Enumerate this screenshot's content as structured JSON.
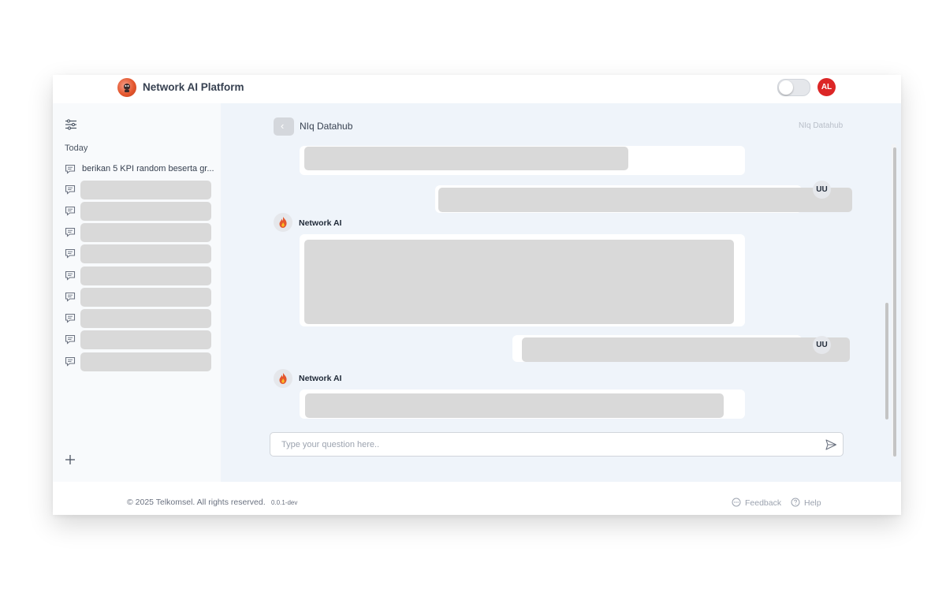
{
  "header": {
    "app_title": "Network AI Platform",
    "user_initials": "AL",
    "theme_toggle": "off"
  },
  "sidebar": {
    "section_label": "Today",
    "items": [
      {
        "label": "berikan 5 KPI random beserta gr..."
      },
      {
        "label": ""
      },
      {
        "label": ""
      },
      {
        "label": ""
      },
      {
        "label": ""
      },
      {
        "label": ""
      },
      {
        "label": ""
      },
      {
        "label": ""
      },
      {
        "label": ""
      },
      {
        "label": ""
      }
    ]
  },
  "chat": {
    "title": "NIq Datahub",
    "subtitle": "NIq Datahub",
    "user_initials": "UU",
    "assistant_name": "Network AI",
    "input_placeholder": "Type your question here.."
  },
  "footer": {
    "copyright": "© 2025 Telkomsel. All rights reserved.",
    "version": "0.0.1-dev",
    "feedback": "Feedback",
    "help": "Help"
  },
  "colors": {
    "accent": "#dc2626",
    "main_bg": "#eff4fa",
    "skeleton": "#d9d9d9"
  }
}
